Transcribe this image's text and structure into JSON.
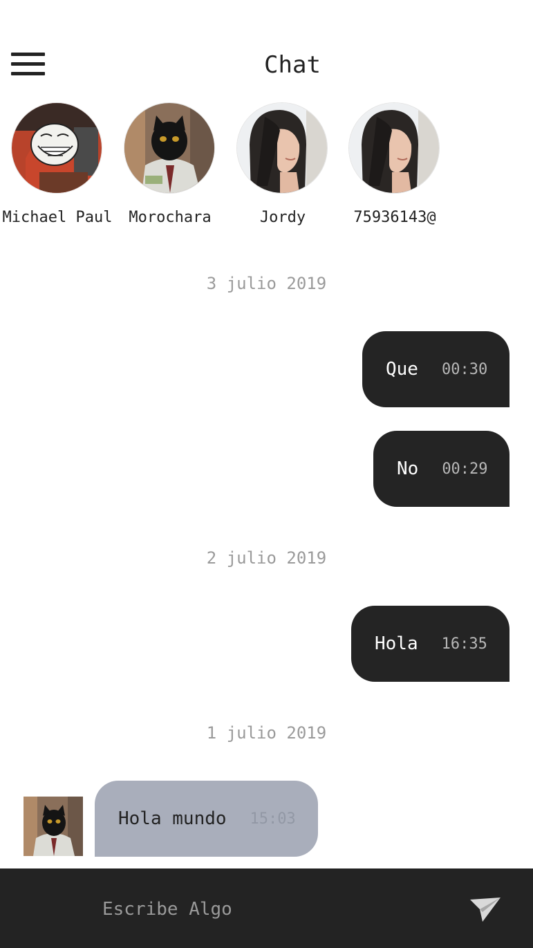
{
  "header": {
    "title": "Chat",
    "menu_icon": "hamburger-menu-icon"
  },
  "contacts": [
    {
      "name": "Michael Paul",
      "avatar": "troll-face-avatar"
    },
    {
      "name": "Morochara",
      "avatar": "black-cat-avatar"
    },
    {
      "name": "Jordy",
      "avatar": "woman-portrait-avatar"
    },
    {
      "name": "75936143@",
      "avatar": "woman-portrait-avatar"
    }
  ],
  "conversation": {
    "groups": [
      {
        "date": "3 julio 2019",
        "messages": [
          {
            "text": "Que",
            "time": "00:30",
            "direction": "sent"
          },
          {
            "text": "No",
            "time": "00:29",
            "direction": "sent"
          }
        ]
      },
      {
        "date": "2 julio 2019",
        "messages": [
          {
            "text": "Hola",
            "time": "16:35",
            "direction": "sent"
          }
        ]
      },
      {
        "date": "1 julio 2019",
        "messages": [
          {
            "text": "Hola mundo",
            "time": "15:03",
            "direction": "received",
            "avatar": "black-cat-avatar"
          }
        ]
      }
    ]
  },
  "composer": {
    "placeholder": "Escribe Algo",
    "send_icon": "paper-plane-send-icon"
  },
  "colors": {
    "sent_bubble": "#242424",
    "received_bubble": "#a9aebb",
    "input_bar": "#232323",
    "date_text": "#9a9a9a"
  }
}
